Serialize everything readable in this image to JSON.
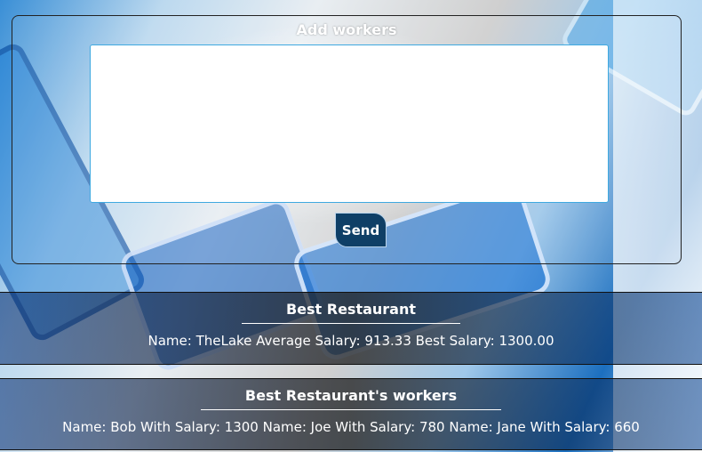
{
  "form": {
    "title": "Add workers",
    "input_value": "",
    "send_label": "Send"
  },
  "best_restaurant": {
    "title": "Best Restaurant",
    "summary": "Name: TheLake Average Salary: 913.33 Best Salary: 1300.00"
  },
  "best_workers": {
    "title": "Best Restaurant's workers",
    "summary": "Name: Bob With Salary: 1300 Name: Joe With Salary: 780 Name: Jane With Salary: 660"
  }
}
